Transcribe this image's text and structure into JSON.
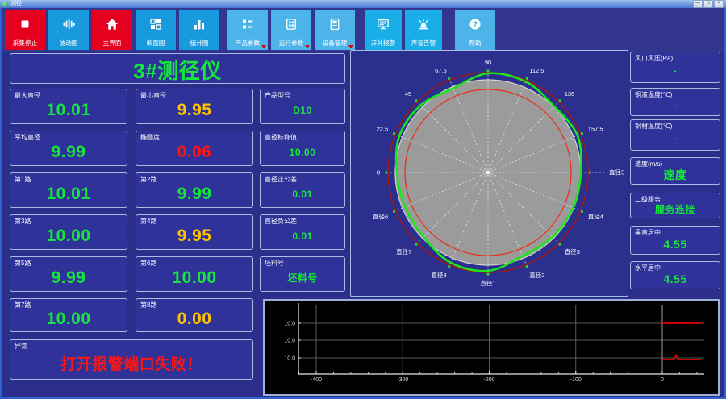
{
  "window": {
    "title": "测径",
    "minimize_glyph": "—",
    "maximize_glyph": "□",
    "close_glyph": "×"
  },
  "toolbar": {
    "buttons": [
      {
        "label": "采集停止",
        "style": "red",
        "icon": "stop-icon"
      },
      {
        "label": "波动图",
        "style": "blue",
        "icon": "waveform-icon"
      },
      {
        "label": "主界面",
        "style": "red",
        "icon": "home-icon"
      },
      {
        "label": "断面图",
        "style": "blue",
        "icon": "cross-section-icon"
      },
      {
        "label": "统计图",
        "style": "blue",
        "icon": "bar-chart-icon"
      },
      {
        "label": "产品参数",
        "style": "lightblue",
        "icon": "product-params-icon",
        "dropdown": true
      },
      {
        "label": "运行参数",
        "style": "lightblue",
        "icon": "run-params-icon",
        "dropdown": true
      },
      {
        "label": "设备管理",
        "style": "lightblue",
        "icon": "device-manage-icon",
        "dropdown": true
      },
      {
        "label": "开外报警",
        "style": "cyan",
        "icon": "external-alarm-icon"
      },
      {
        "label": "声音告警",
        "style": "cyan",
        "icon": "sound-alarm-icon"
      },
      {
        "label": "帮助",
        "style": "lightblue",
        "icon": "help-icon"
      }
    ]
  },
  "gauge_title": "3#测径仪",
  "cards": [
    {
      "label": "最大直径",
      "value": "10.01",
      "color": "green"
    },
    {
      "label": "最小直径",
      "value": "9.95",
      "color": "yellow"
    },
    {
      "label": "产品型号",
      "value": "D10",
      "color": "green"
    },
    {
      "label": "平均直径",
      "value": "9.99",
      "color": "green"
    },
    {
      "label": "椭圆度",
      "value": "0.06",
      "color": "red"
    },
    {
      "label": "直径标称值",
      "value": "10.00",
      "color": "green"
    },
    {
      "label": "第1路",
      "value": "10.01",
      "color": "green"
    },
    {
      "label": "第2路",
      "value": "9.99",
      "color": "green"
    },
    {
      "label": "直径正公差",
      "value": "0.01",
      "color": "green"
    },
    {
      "label": "第3路",
      "value": "10.00",
      "color": "green"
    },
    {
      "label": "第4路",
      "value": "9.95",
      "color": "yellow"
    },
    {
      "label": "直径负公差",
      "value": "0.01",
      "color": "green"
    },
    {
      "label": "第5路",
      "value": "9.99",
      "color": "green"
    },
    {
      "label": "第6路",
      "value": "10.00",
      "color": "green"
    },
    {
      "label": "坯料号",
      "value": "坯料号",
      "color": "green"
    },
    {
      "label": "第7路",
      "value": "10.00",
      "color": "green"
    },
    {
      "label": "第8路",
      "value": "0.00",
      "color": "yellow"
    },
    {
      "label": "异常",
      "value": "打开报警端口失败！",
      "color": "red"
    }
  ],
  "right_panels": [
    {
      "label": "风口风压(Pa)",
      "value": "-",
      "size": "sm"
    },
    {
      "label": "铜液温度(℃)",
      "value": "-",
      "size": "sm"
    },
    {
      "label": "铜材温度(℃)",
      "value": "-",
      "size": "sm"
    },
    {
      "label": "速度(m/s)",
      "value": "速度",
      "size": "lg"
    },
    {
      "label": "二级服务",
      "value": "服务连接",
      "size": "md"
    },
    {
      "label": "垂直居中",
      "value": "4.55",
      "size": "lg"
    },
    {
      "label": "水平居中",
      "value": "4.55",
      "size": "lg"
    }
  ],
  "polar_chart": {
    "spokes": [
      {
        "angle": 0,
        "label": "直径5"
      },
      {
        "angle": 22.5,
        "label": "157.5"
      },
      {
        "angle": 45,
        "label": "135"
      },
      {
        "angle": 67.5,
        "label": "112.5"
      },
      {
        "angle": 90,
        "label": "90"
      },
      {
        "angle": 112.5,
        "label": "67.5"
      },
      {
        "angle": 135,
        "label": "45"
      },
      {
        "angle": 157.5,
        "label": "22.5"
      },
      {
        "angle": 180,
        "label": "0"
      },
      {
        "angle": 202.5,
        "label": "直径6"
      },
      {
        "angle": 225,
        "label": "直径7"
      },
      {
        "angle": 247.5,
        "label": "直径8"
      },
      {
        "angle": 270,
        "label": "直径1"
      },
      {
        "angle": 292.5,
        "label": "直径2"
      },
      {
        "angle": 315,
        "label": "直径3"
      },
      {
        "angle": 337.5,
        "label": "直径4"
      }
    ],
    "disk_radius": 115,
    "nominal_radius": 103,
    "tolerance_radius": 124,
    "green_profile": [
      [
        0,
        115
      ],
      [
        22.5,
        120
      ],
      [
        45,
        116
      ],
      [
        67.5,
        122
      ],
      [
        90,
        123
      ],
      [
        112.5,
        113
      ],
      [
        135,
        118
      ],
      [
        157.5,
        119
      ],
      [
        180,
        113
      ],
      [
        202.5,
        111
      ],
      [
        225,
        113
      ],
      [
        247.5,
        121
      ],
      [
        270,
        122
      ],
      [
        292.5,
        112
      ],
      [
        315,
        113
      ],
      [
        337.5,
        114
      ]
    ],
    "colors": {
      "disk": "#9b9b9b",
      "disk_edge": "#d2d2d2",
      "nominal": "#e83018",
      "tolerance": "#a01818",
      "profile": "#1ae61a",
      "spoke": "#eeeeee",
      "label": "#ffffff",
      "marker": "#2ae02a"
    }
  },
  "trend_chart": {
    "x_ticks": [
      {
        "v": -400,
        "label": "-400"
      },
      {
        "v": -300,
        "label": "-300"
      },
      {
        "v": -200,
        "label": "-200"
      },
      {
        "v": -100,
        "label": "-100"
      },
      {
        "v": 0,
        "label": "0"
      }
    ],
    "x_min": -420,
    "x_max": 45,
    "x_minor_step": 20,
    "y_gridlines": [
      {
        "y": 28,
        "label": "10.0"
      },
      {
        "y": 49,
        "label": "10.0"
      },
      {
        "y": 71,
        "label": "10.0"
      }
    ],
    "red_lines": [
      {
        "y": 28,
        "from_v": 0,
        "spike_v": null
      },
      {
        "y": 73,
        "from_v": 0,
        "spike_v": 16
      }
    ],
    "colors": {
      "axis": "#e6e6e6",
      "grid": "#5a5a5a",
      "zero": "#9c9c9c",
      "line": "#c80000",
      "text": "#dddddd"
    }
  }
}
